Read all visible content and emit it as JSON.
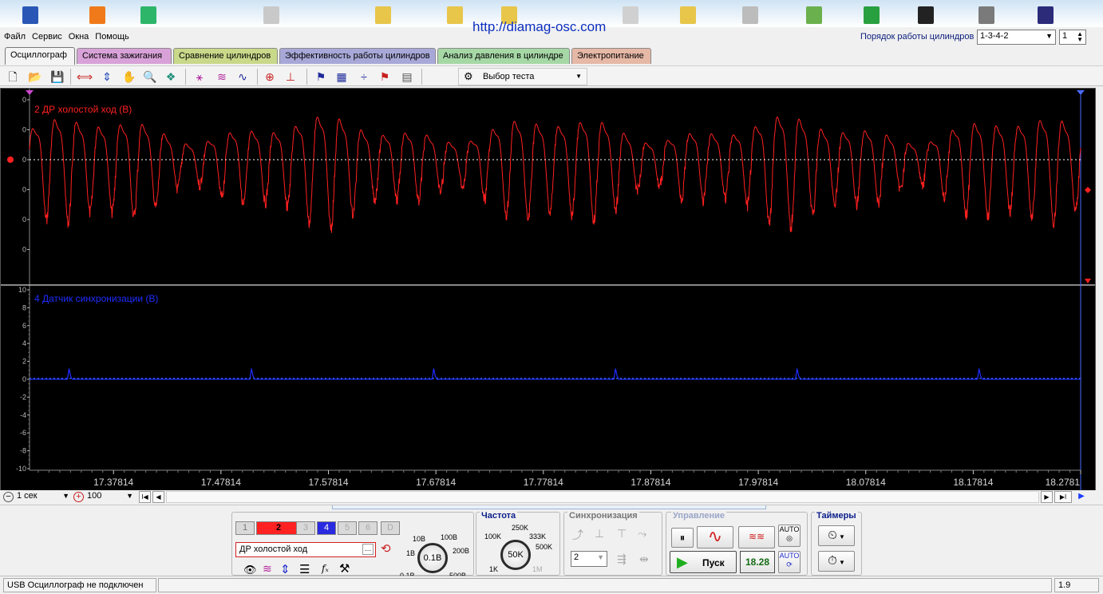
{
  "url_banner": "http://diamag-osc.com",
  "menu": [
    "Файл",
    "Сервис",
    "Окна",
    "Помощь"
  ],
  "cylinder_order": {
    "label": "Порядок работы цилиндров",
    "value": "1-3-4-2",
    "spin_value": "1"
  },
  "tabs": [
    {
      "label": "Осциллограф",
      "color": "#f4f4f4",
      "active": true
    },
    {
      "label": "Система зажигания",
      "color": "#d8a2d8"
    },
    {
      "label": "Сравнение цилиндров",
      "color": "#c8d98a"
    },
    {
      "label": "Эффективность работы цилиндров",
      "color": "#a8a8d8"
    },
    {
      "label": "Анализ давления в цилиндре",
      "color": "#a6d8a6"
    },
    {
      "label": "Электропитание",
      "color": "#e6b8a6"
    }
  ],
  "toolbar": {
    "test_select": "Выбор теста"
  },
  "channels": {
    "top": {
      "label": "2 ДР холостой ход (В)",
      "color": "#ff2020",
      "y_ticks": [
        "0",
        "0",
        "0",
        "0",
        "0",
        "0"
      ]
    },
    "bottom": {
      "label": "4 Датчик синхронизации (В)",
      "color": "#1e2cff",
      "y_ticks": [
        "10",
        "8",
        "6",
        "4",
        "2",
        "0",
        "-2",
        "-4",
        "-6",
        "-8",
        "-10"
      ]
    }
  },
  "chart_data": {
    "type": "line",
    "xlabel": "",
    "ylabel": "",
    "x_ticks": [
      "17.37814",
      "17.47814",
      "17.57814",
      "17.67814",
      "17.77814",
      "17.87814",
      "17.97814",
      "18.07814",
      "18.17814",
      "18.2781"
    ],
    "series": [
      {
        "name": "2 ДР холостой ход (В)",
        "color": "#ff2020",
        "panel": "top",
        "peak_count": 48
      },
      {
        "name": "4 Датчик синхронизации (В)",
        "color": "#1e2cff",
        "panel": "bottom",
        "ylim": [
          -10,
          10
        ],
        "baseline": 0,
        "pulse_height": 1.2,
        "pulse_x": [
          17.3375,
          17.5073,
          17.6768,
          17.846,
          18.015,
          18.1843
        ]
      }
    ],
    "xlim": [
      17.3,
      18.2781
    ],
    "grid": true
  },
  "timebar": {
    "time_scale": "1 сек",
    "zoom": "100"
  },
  "channel_buttons": [
    "1",
    "2",
    "3",
    "4",
    "5",
    "6",
    "D"
  ],
  "channel_settings": {
    "name": "ДР холостой ход",
    "knob_value": "0.1В",
    "knob_labels": [
      "10В",
      "1В",
      "200В",
      "0,1В",
      "500В"
    ]
  },
  "frequency": {
    "title": "Частота",
    "knob_value": "50K",
    "labels": [
      "250K",
      "100K",
      "333K",
      "500K",
      "1K",
      "1M"
    ]
  },
  "sync": {
    "title": "Синхронизация",
    "channel": "2"
  },
  "control": {
    "title": "Управление",
    "start_label": "Пуск",
    "value_display": "18.28"
  },
  "timers": {
    "title": "Таймеры"
  },
  "status": {
    "left": "USB Осциллограф не подключен",
    "right": "1.9"
  }
}
